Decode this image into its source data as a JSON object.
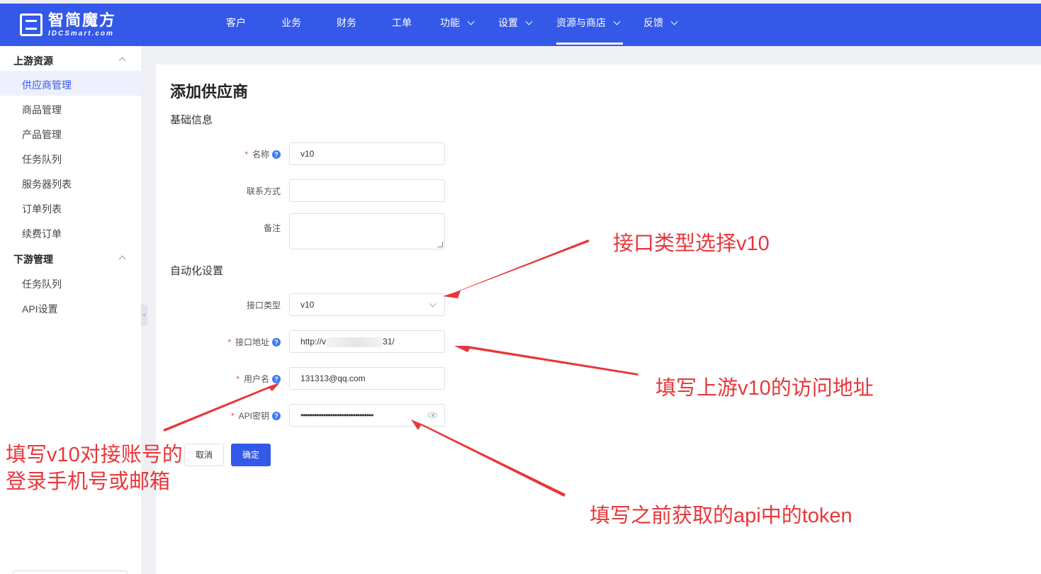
{
  "brand": {
    "name_cn": "智简魔方",
    "name_en": "IDCSmart.com"
  },
  "topnav": {
    "items": [
      {
        "label": "客户",
        "has_dropdown": false
      },
      {
        "label": "业务",
        "has_dropdown": false
      },
      {
        "label": "财务",
        "has_dropdown": false
      },
      {
        "label": "工单",
        "has_dropdown": false
      },
      {
        "label": "功能",
        "has_dropdown": true
      },
      {
        "label": "设置",
        "has_dropdown": true
      },
      {
        "label": "资源与商店",
        "has_dropdown": true,
        "active": true
      },
      {
        "label": "反馈",
        "has_dropdown": true
      }
    ]
  },
  "sidebar": {
    "groups": [
      {
        "title": "上游资源",
        "items": [
          "供应商管理",
          "商品管理",
          "产品管理",
          "任务队列",
          "服务器列表",
          "订单列表",
          "续费订单"
        ],
        "active_item": "供应商管理"
      },
      {
        "title": "下游管理",
        "items": [
          "任务队列",
          "API设置"
        ]
      }
    ]
  },
  "form": {
    "title": "添加供应商",
    "section_basic": "基础信息",
    "section_auto": "自动化设置",
    "name": {
      "label": "名称",
      "value": "v10",
      "required": true
    },
    "contact": {
      "label": "联系方式",
      "value": ""
    },
    "remark": {
      "label": "备注",
      "value": ""
    },
    "api_type": {
      "label": "接口类型",
      "value": "v10"
    },
    "api_url": {
      "label": "接口地址",
      "value_prefix": "http://v",
      "value_suffix": "31/",
      "required": true
    },
    "username": {
      "label": "用户名",
      "value": "131313@qq.com",
      "required": true
    },
    "api_key": {
      "label": "API密钥",
      "value": "••••••••••••••••••••••••••••••••",
      "required": true
    },
    "cancel_label": "取消",
    "confirm_label": "确定"
  },
  "annotations": {
    "api_type": "接口类型选择v10",
    "api_url": "填写上游v10的访问地址",
    "username_line1": "填写v10对接账号的",
    "username_line2": "登录手机号或邮箱",
    "api_key": "填写之前获取的api中的token"
  },
  "colors": {
    "primary": "#3458e8",
    "annotation": "#e8373a",
    "required": "#e34d4d"
  }
}
